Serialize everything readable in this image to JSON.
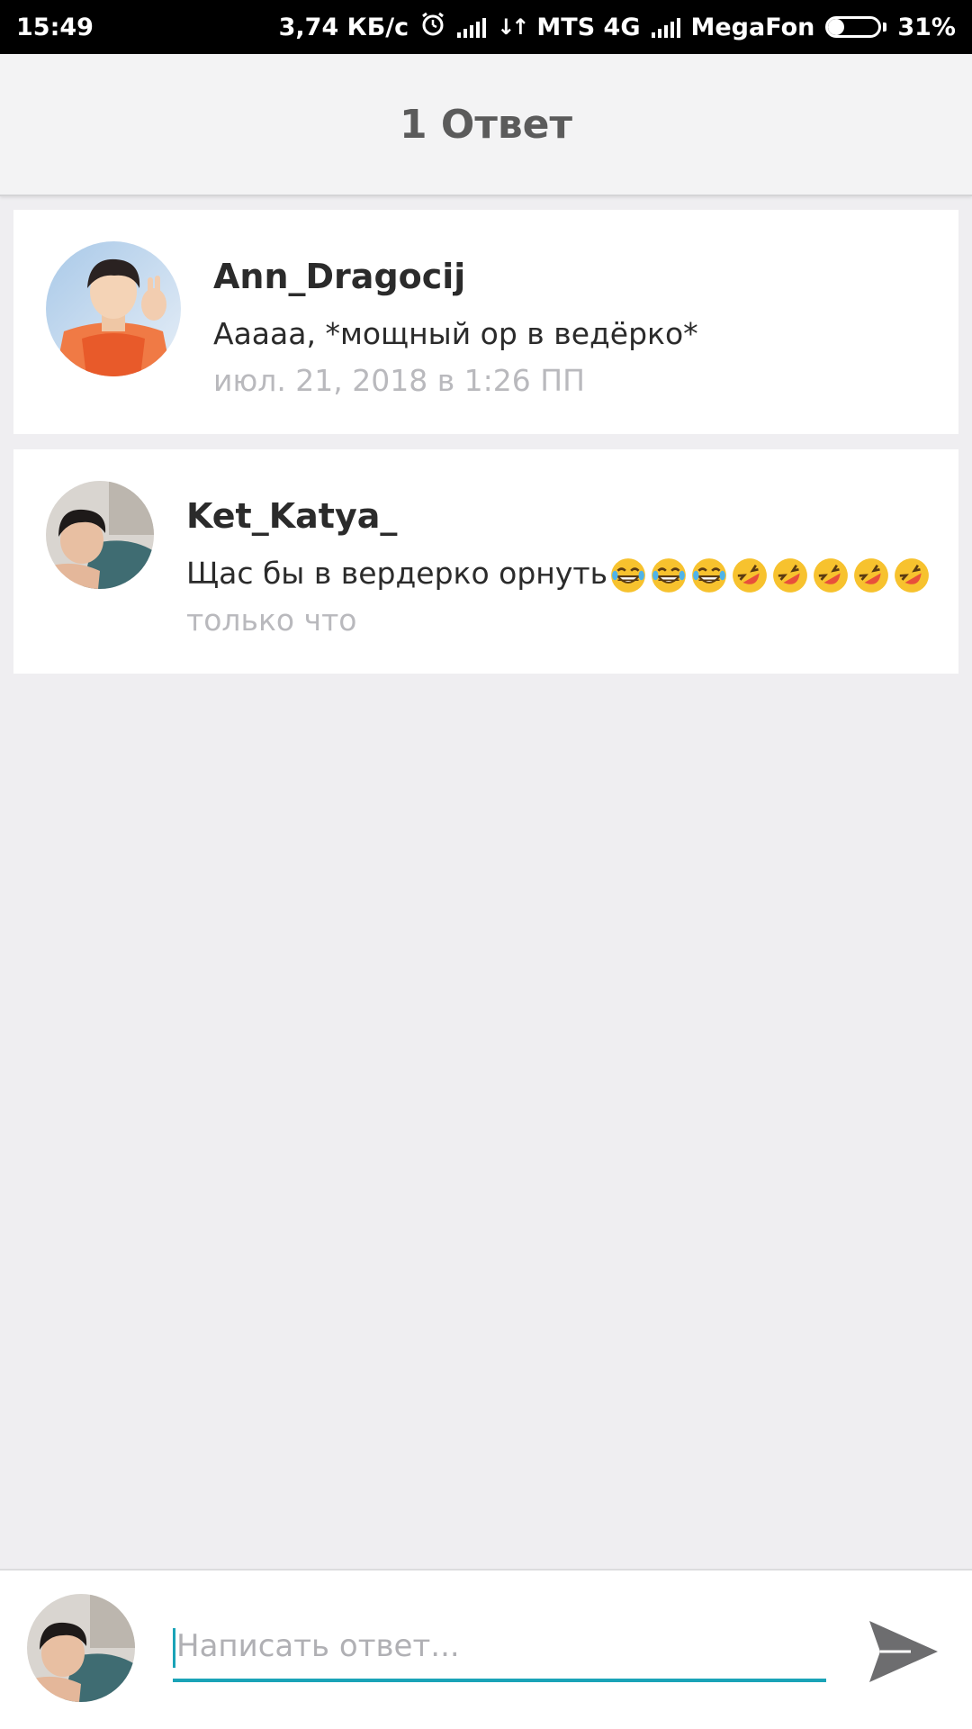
{
  "status_bar": {
    "time": "15:49",
    "net_speed": "3,74 КБ/с",
    "carrier_1": "MTS 4G",
    "carrier_2": "MegaFon",
    "battery_text": "31%",
    "battery_level": 0.31,
    "icons": [
      "alarm-icon",
      "signal-icon",
      "data-arrows-icon",
      "signal-icon",
      "battery-icon"
    ]
  },
  "header": {
    "title": "1 Ответ"
  },
  "comments": [
    {
      "username": "Ann_Dragocij",
      "message": "Ааааа, *мощный ор в ведёрко*",
      "timestamp": "июл. 21, 2018 в 1:26 ПП",
      "avatar": "user-photo"
    },
    {
      "username": "Ket_Katya_",
      "message": "Щас бы в вердерко орнуть",
      "emojis": [
        "😂",
        "😂",
        "😂",
        "🤣",
        "🤣",
        "🤣",
        "🤣",
        "🤣"
      ],
      "timestamp": "только что",
      "avatar": "user-photo"
    }
  ],
  "compose": {
    "placeholder": "Написать ответ...",
    "value": "",
    "send_icon": "send-icon",
    "accent_color": "#1aa3b7"
  },
  "colors": {
    "background": "#efeef1",
    "card": "#ffffff",
    "timestamp": "#b9b9bd",
    "header_title": "#5b5b5b"
  }
}
